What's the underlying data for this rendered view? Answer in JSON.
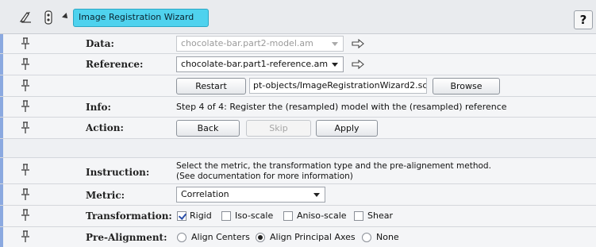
{
  "header": {
    "title": "Image Registration Wizard",
    "help_label": "?"
  },
  "rows": {
    "data": {
      "label": "Data:",
      "value": "chocolate-bar.part2-model.am"
    },
    "reference": {
      "label": "Reference:",
      "value": "chocolate-bar.part1-reference.am"
    },
    "script": {
      "restart_label": "Restart",
      "path": "pt-objects/ImageRegistrationWizard2.scro",
      "browse_label": "Browse"
    },
    "info": {
      "label": "Info:",
      "text": "Step 4 of 4: Register the (resampled) model with the (resampled) reference"
    },
    "action": {
      "label": "Action:",
      "back_label": "Back",
      "skip_label": "Skip",
      "apply_label": "Apply"
    },
    "instruction": {
      "label": "Instruction:",
      "line1": "Select the metric, the transformation type and the pre-alignement method.",
      "line2": "(See documentation for more information)"
    },
    "metric": {
      "label": "Metric:",
      "value": "Correlation"
    },
    "transformation": {
      "label": "Transformation:",
      "options": [
        {
          "label": "Rigid",
          "checked": true
        },
        {
          "label": "Iso-scale",
          "checked": false
        },
        {
          "label": "Aniso-scale",
          "checked": false
        },
        {
          "label": "Shear",
          "checked": false
        }
      ]
    },
    "prealign": {
      "label": "Pre-Alignment:",
      "options": [
        {
          "label": "Align Centers",
          "selected": false
        },
        {
          "label": "Align Principal Axes",
          "selected": true
        },
        {
          "label": "None",
          "selected": false
        }
      ]
    }
  },
  "colors": {
    "accent": "#4fd2ee",
    "strip": "#8ba9e0"
  }
}
